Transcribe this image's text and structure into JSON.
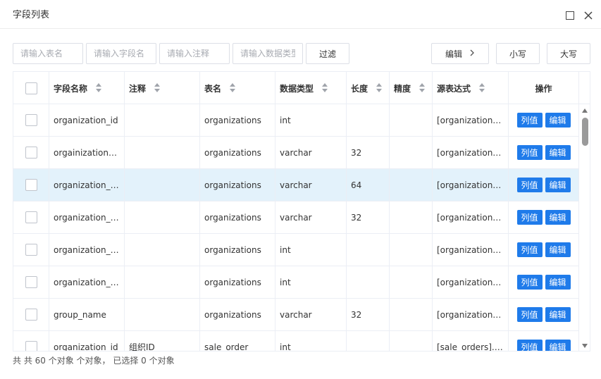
{
  "dialog": {
    "title": "字段列表"
  },
  "filters": {
    "table_name_placeholder": "请输入表名",
    "field_name_placeholder": "请输入字段名",
    "comment_placeholder": "请输入注释",
    "data_type_placeholder": "请输入数据类型",
    "filter_label": "过滤"
  },
  "toolbar": {
    "edit_label": "编辑",
    "lowercase_label": "小写",
    "uppercase_label": "大写"
  },
  "columns": [
    "字段名称",
    "注释",
    "表名",
    "数据类型",
    "长度",
    "精度",
    "源表达式",
    "操作"
  ],
  "rows": [
    {
      "field": "organization_id",
      "comment": "",
      "table": "organizations",
      "type": "int",
      "length": "",
      "precision": "",
      "source": "[organizations].[organization_id]"
    },
    {
      "field": "orgainization_code",
      "comment": "",
      "table": "organizations",
      "type": "varchar",
      "length": "32",
      "precision": "",
      "source": "[organizations].[orgainization_code]"
    },
    {
      "field": "organization_name",
      "comment": "",
      "table": "organizations",
      "type": "varchar",
      "length": "64",
      "precision": "",
      "source": "[organizations].[organization_name]"
    },
    {
      "field": "organization_status",
      "comment": "",
      "table": "organizations",
      "type": "varchar",
      "length": "32",
      "precision": "",
      "source": "[organizations].[organization_status]"
    },
    {
      "field": "organization_parent",
      "comment": "",
      "table": "organizations",
      "type": "int",
      "length": "",
      "precision": "",
      "source": "[organizations].[organization_parent]"
    },
    {
      "field": "organization_level",
      "comment": "",
      "table": "organizations",
      "type": "int",
      "length": "",
      "precision": "",
      "source": "[organizations].[organization_level]"
    },
    {
      "field": "group_name",
      "comment": "",
      "table": "organizations",
      "type": "varchar",
      "length": "32",
      "precision": "",
      "source": "[organizations].[group_name]"
    },
    {
      "field": "organization_id",
      "comment": "组织ID",
      "table": "sale_order",
      "type": "int",
      "length": "",
      "precision": "",
      "source": "[sale_orders].[organization_id]"
    }
  ],
  "actions": {
    "values_label": "列值",
    "edit_label": "编辑"
  },
  "footer": {
    "summary": "共 共 60 个对象 个对象， 已选择 0 个对象"
  },
  "colors": {
    "primary": "#1f7bea",
    "row_highlight": "#e3f2fb"
  }
}
